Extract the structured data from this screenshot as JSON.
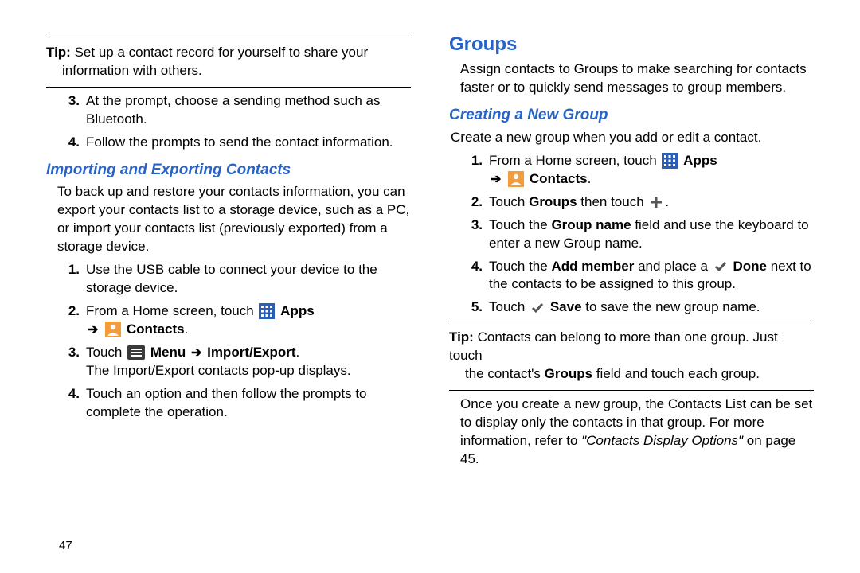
{
  "page_number": "47",
  "left": {
    "tip": {
      "label": "Tip:",
      "text1": "Set up a contact record for yourself to share your",
      "text2": "information with others."
    },
    "steps_a": {
      "s3": {
        "n": "3.",
        "text": "At the prompt, choose a sending method such as Bluetooth."
      },
      "s4": {
        "n": "4.",
        "text": "Follow the prompts to send the contact information."
      }
    },
    "heading_import": "Importing and Exporting Contacts",
    "import_intro": "To back up and restore your contacts information, you can export your contacts list to a storage device, such as a PC, or import your contacts list (previously exported) from a storage device.",
    "steps_b": {
      "s1": {
        "n": "1.",
        "text": "Use the USB cable to connect your device to the storage device."
      },
      "s2": {
        "n": "2.",
        "pre": "From a Home screen, touch ",
        "apps": "Apps",
        "contacts": "Contacts",
        "dot": "."
      },
      "s3": {
        "n": "3.",
        "pre": "Touch ",
        "menu": "Menu",
        "importexport": "Import/Export",
        "after": ".",
        "line2": "The Import/Export contacts pop-up displays."
      },
      "s4": {
        "n": "4.",
        "text": "Touch an option and then follow the prompts to complete the operation."
      }
    }
  },
  "right": {
    "heading_groups": "Groups",
    "groups_intro": "Assign contacts to Groups to make searching for contacts faster or to quickly send messages to group members.",
    "heading_create": "Creating a New Group",
    "create_intro": "Create a new group when you add or edit a contact.",
    "steps": {
      "s1": {
        "n": "1.",
        "pre": "From a Home screen, touch ",
        "apps": "Apps",
        "contacts": "Contacts",
        "dot": "."
      },
      "s2": {
        "n": "2.",
        "pre": "Touch ",
        "groups": "Groups",
        "mid": "  then touch ",
        "dot": "."
      },
      "s3": {
        "n": "3.",
        "pre": "Touch the ",
        "groupname": "Group name",
        "after": " field and use the keyboard to enter a new Group name."
      },
      "s4": {
        "n": "4.",
        "pre": "Touch the ",
        "addmember": "Add member",
        "mid": " and place a ",
        "done": "Done",
        "after": " next to the contacts to be assigned to this group."
      },
      "s5": {
        "n": "5.",
        "pre": "Touch ",
        "save": "Save",
        "after": " to save the new group name."
      }
    },
    "tip": {
      "label": "Tip:",
      "text1": "Contacts can belong to more than one group. Just touch",
      "text2_pre": "the contact's ",
      "text2_bold": "Groups",
      "text2_post": " field and touch each group."
    },
    "after_tip_pre": "Once you create a new group, the Contacts List can be set to display only the contacts in that group. For more information, refer to ",
    "after_tip_ref": "\"Contacts Display Options\"",
    "after_tip_post": " on page 45."
  }
}
